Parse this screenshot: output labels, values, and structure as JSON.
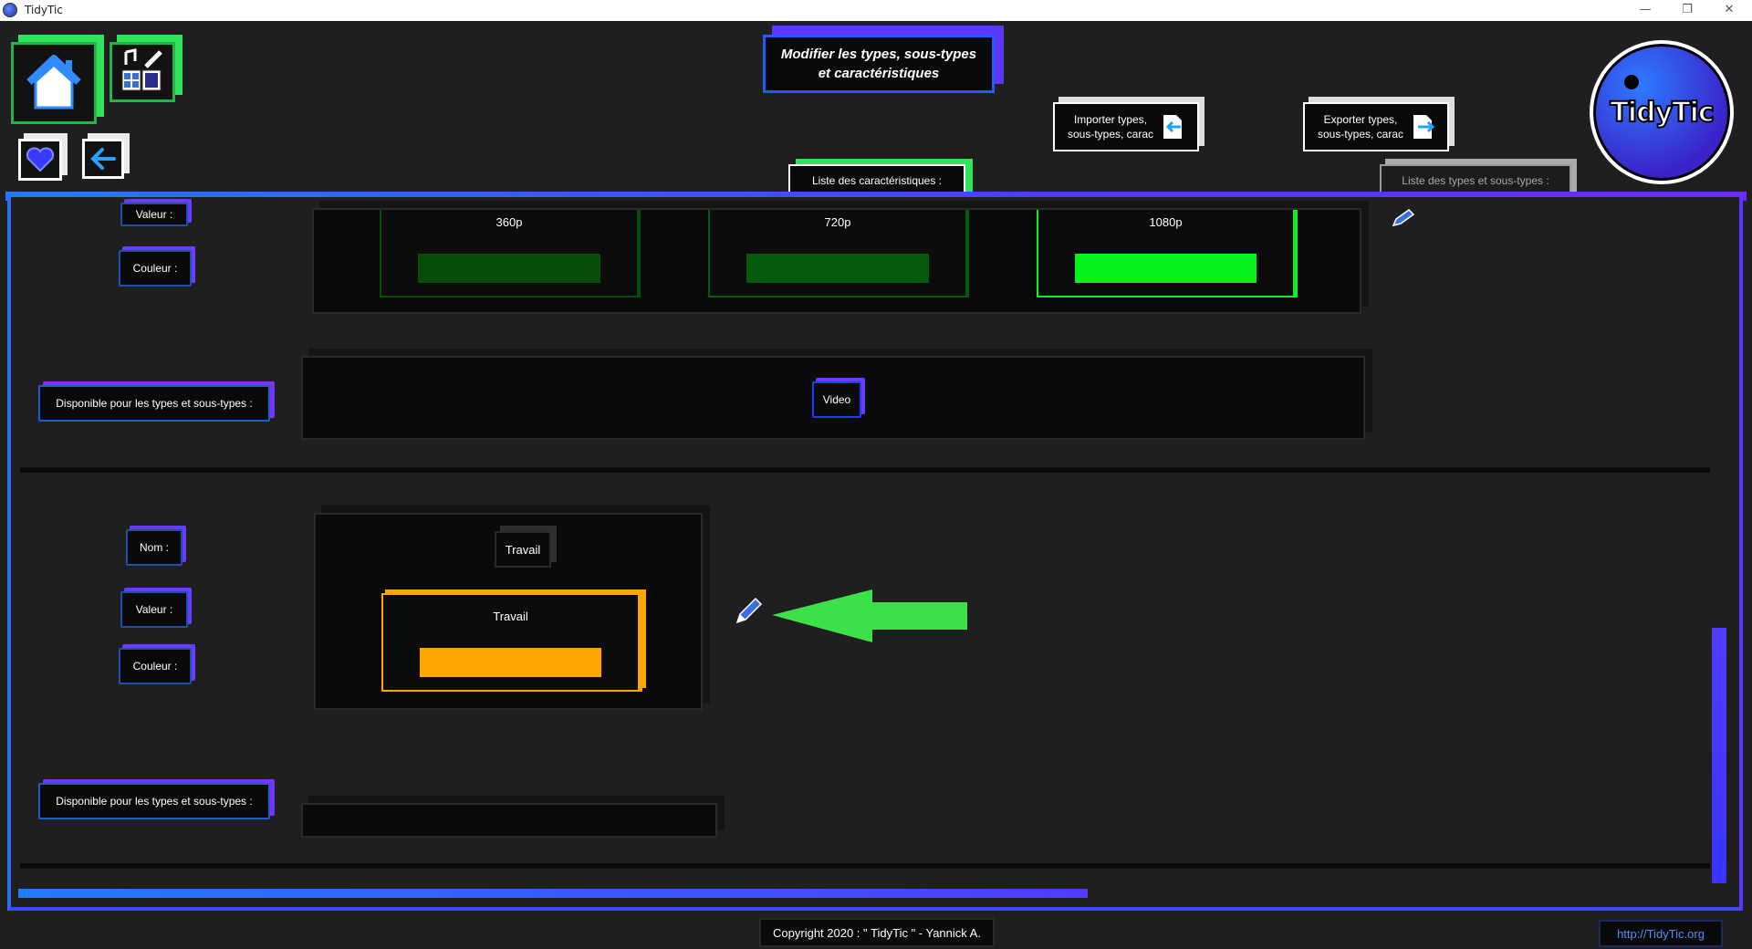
{
  "window": {
    "title": "TidyTic",
    "minimize": "—",
    "restore": "❐",
    "close": "✕"
  },
  "header": {
    "title_line1": "Modifier les types, sous-types",
    "title_line2": "et caractéristiques",
    "import_line1": "Importer types,",
    "import_line2": "sous-types, carac",
    "export_line1": "Exporter types,",
    "export_line2": "sous-types, carac",
    "logo_text": "TidyTic"
  },
  "tabs": {
    "characteristics": "Liste des caractéristiques :",
    "types": "Liste des types et sous-types :"
  },
  "section1": {
    "valeur_label": "Valeur :",
    "couleur_label": "Couleur :",
    "values": [
      {
        "label": "360p",
        "color": "#064d0a"
      },
      {
        "label": "720p",
        "color": "#075a0c"
      },
      {
        "label": "1080p",
        "color": "#08f21e"
      }
    ],
    "available_label": "Disponible pour les types et sous-types :",
    "available_types": [
      "Video"
    ]
  },
  "section2": {
    "nom_label": "Nom :",
    "valeur_label": "Valeur :",
    "couleur_label": "Couleur :",
    "name_value": "Travail",
    "values": [
      {
        "label": "Travail",
        "color": "#ffa500"
      }
    ],
    "available_label": "Disponible pour les types et sous-types :"
  },
  "footer": {
    "copyright": "Copyright 2020 : \" TidyTic \" - Yannick A.",
    "link": "http://TidyTic.org"
  },
  "colors": {
    "accent_blue": "#1f7bff",
    "accent_purple": "#6b2cff",
    "accent_green": "#2fe35a",
    "annotation_arrow": "#3ee04a"
  }
}
